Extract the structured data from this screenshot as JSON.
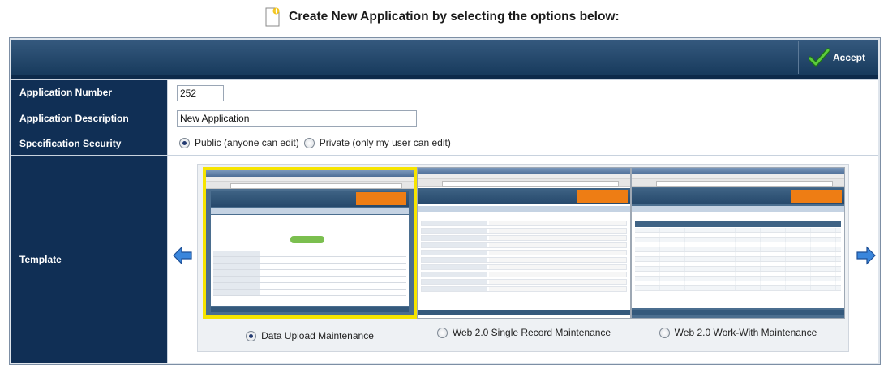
{
  "page": {
    "title": "Create New Application by selecting the options below:"
  },
  "toolbar": {
    "accept_label": "Accept"
  },
  "form": {
    "application_number": {
      "label": "Application Number",
      "value": "252"
    },
    "application_description": {
      "label": "Application Description",
      "value": "New Application"
    },
    "specification_security": {
      "label": "Specification Security",
      "options": [
        {
          "label": "Public (anyone can edit)",
          "checked": true
        },
        {
          "label": "Private (only my user can edit)",
          "checked": false
        }
      ]
    },
    "template": {
      "label": "Template",
      "options": [
        {
          "label": "Data Upload Maintenance",
          "checked": true
        },
        {
          "label": "Web 2.0 Single Record Maintenance",
          "checked": false
        },
        {
          "label": "Web 2.0 Work-With Maintenance",
          "checked": false
        }
      ]
    }
  },
  "colors": {
    "label_bg": "#102f55",
    "toolbar_bg": "#1f4266",
    "selected_border": "#f6e400",
    "accept_check": "#3fa535",
    "arrow": "#3a7bd5"
  },
  "icons": {
    "title_icon": "new-document-icon",
    "accept_icon": "checkmark-icon",
    "prev_icon": "arrow-left-icon",
    "next_icon": "arrow-right-icon"
  }
}
